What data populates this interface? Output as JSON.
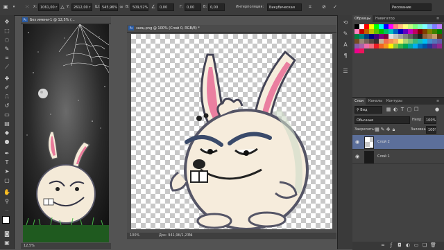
{
  "options_bar": {
    "x_label": "X:",
    "x_value": "1061,00 r",
    "y_label": "Y:",
    "y_value": "2612,00 r",
    "w_label": "Ш:",
    "w_value": "545,96%",
    "h_label": "В:",
    "h_value": "509,52%",
    "angle_value": "0,00",
    "skew_h_label": "Г:",
    "skew_h_value": "0,00",
    "skew_v_label": "В:",
    "skew_v_value": "0,00",
    "interp_label": "Интерполяция:",
    "interp_value": "Бикубическая",
    "workspace_value": "Рисование"
  },
  "doc_left": {
    "title": "Без имени-1 @ 12,5% (...",
    "zoom": "12,5%"
  },
  "doc_main": {
    "title": "заяц.png @ 100% (Слой 0, RGB/8) *",
    "zoom": "100%",
    "doc_size": "Док: 941,9K/1,23M"
  },
  "swatches_panel": {
    "tab_swatches": "Образцы",
    "tab_navigator": "Навигатор",
    "colors": [
      "#000000",
      "#ffffff",
      "#ff0000",
      "#ffff00",
      "#00ff00",
      "#00ffff",
      "#0000ff",
      "#ff00ff",
      "#ff7f7f",
      "#ffbf7f",
      "#ffff7f",
      "#bfff7f",
      "#7fff7f",
      "#7fffbf",
      "#7fffff",
      "#7fbfff",
      "#7f7fff",
      "#bf7fff",
      "#ff7fbf",
      "#c00000",
      "#c06000",
      "#c0c000",
      "#60c000",
      "#00c000",
      "#00c060",
      "#00c0c0",
      "#0060c0",
      "#0000c0",
      "#6000c0",
      "#c000c0",
      "#c00060",
      "#800000",
      "#804000",
      "#808000",
      "#408000",
      "#008000",
      "#008040",
      "#008080",
      "#004080",
      "#000080",
      "#400080",
      "#800080",
      "#800040",
      "#e0e0e0",
      "#c0c0c0",
      "#a0a0a0",
      "#808080",
      "#606060",
      "#404040",
      "#202020",
      "#8c6239",
      "#a67c52",
      "#c69c6d",
      "#603913",
      "#754c24",
      "#998675",
      "#736357",
      "#534741",
      "#362f2d",
      "#c7b299",
      "#f26c4f",
      "#f68e56",
      "#fbaf5d",
      "#fff568",
      "#acd373",
      "#7cc576",
      "#3bb878",
      "#1abbb4",
      "#00bff3",
      "#438ccb",
      "#5574b9",
      "#605ca8",
      "#855fa8",
      "#a864a8",
      "#f06eaa",
      "#f26d7d",
      "#ed1c24",
      "#f26522",
      "#f7941d",
      "#fff200",
      "#8dc63f",
      "#39b54a",
      "#00a651",
      "#00a99d",
      "#00aeef",
      "#0072bc",
      "#0054a6",
      "#2e3192",
      "#662d91",
      "#92278f",
      "#ec008c",
      "#ed145b"
    ]
  },
  "layers_panel": {
    "tab_layers": "Слои",
    "tab_channels": "Каналы",
    "tab_paths": "Контуры",
    "filter_kind": "Вид",
    "blend_mode": "Обычные",
    "opacity_label": "Непр:",
    "opacity_value": "100%",
    "lock_label": "Закрепить:",
    "fill_label": "Заливка:",
    "fill_value": "100%",
    "layers": [
      {
        "name": "Слой 2",
        "selected": true
      },
      {
        "name": "Слой 1",
        "selected": false
      }
    ]
  },
  "accent_color": "#5c6f9a"
}
